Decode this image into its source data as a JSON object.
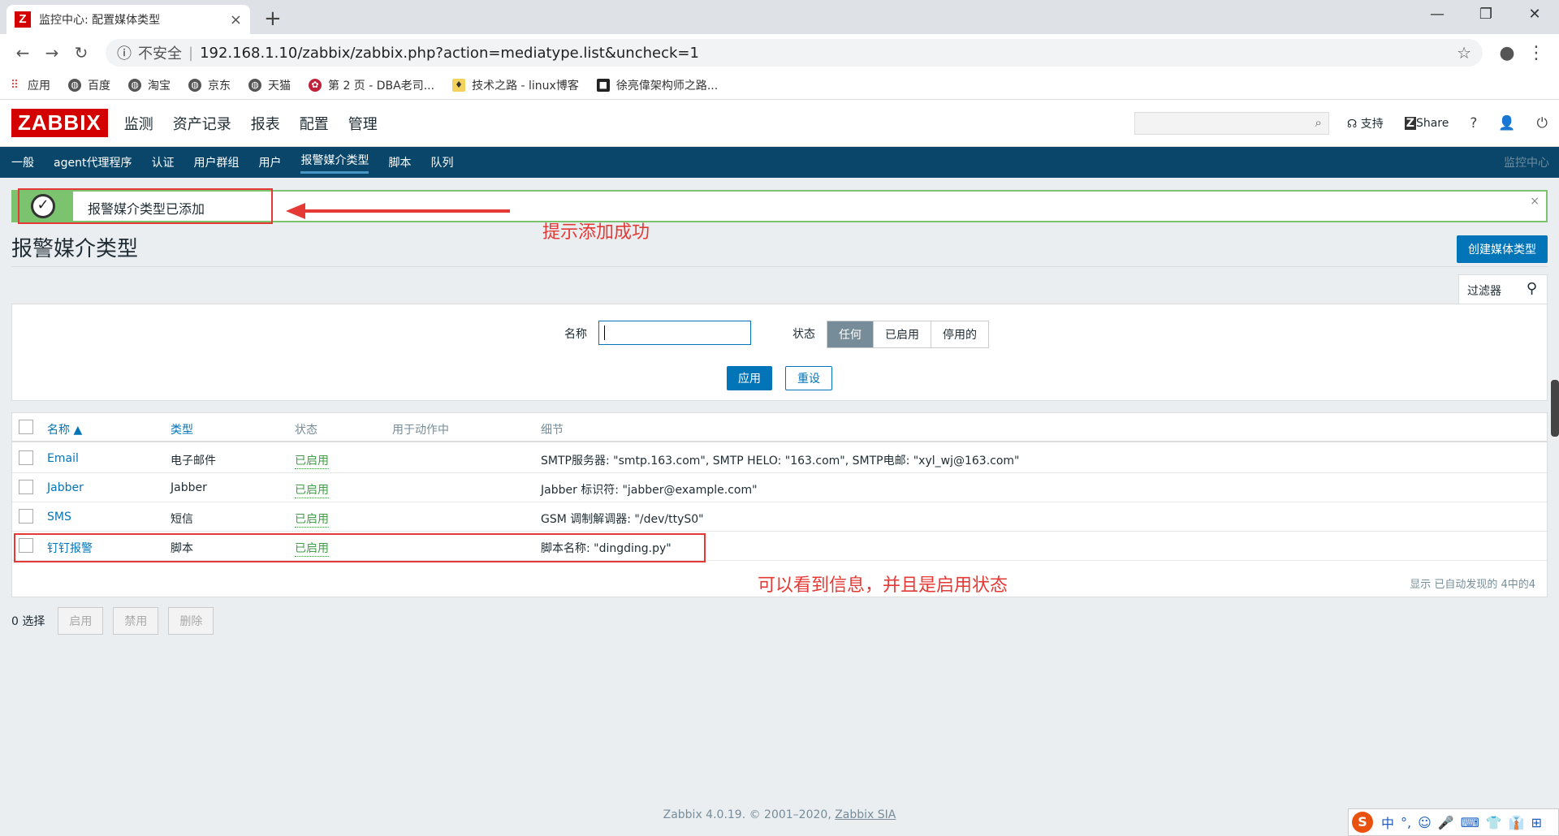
{
  "browser": {
    "tab_title": "监控中心: 配置媒体类型",
    "tab_icon": "Z",
    "insecure_label": "不安全",
    "url": "192.168.1.10/zabbix/zabbix.php?action=mediatype.list&uncheck=1",
    "bookmarks": [
      {
        "label": "应用",
        "icon": "apps-icon"
      },
      {
        "label": "百度",
        "icon": "globe-icon"
      },
      {
        "label": "淘宝",
        "icon": "globe-icon"
      },
      {
        "label": "京东",
        "icon": "globe-icon"
      },
      {
        "label": "天猫",
        "icon": "globe-icon"
      },
      {
        "label": "第 2 页 - DBA老司...",
        "icon": "rose-icon"
      },
      {
        "label": "技术之路 - linux博客",
        "icon": "bulb-icon"
      },
      {
        "label": "徐亮偉架构师之路...",
        "icon": "dark-icon"
      }
    ]
  },
  "zabbix": {
    "logo": "ZABBIX",
    "top_menu": [
      "监测",
      "资产记录",
      "报表",
      "配置",
      "管理"
    ],
    "support": "支持",
    "share": "Share",
    "help": "?",
    "sub_menu": [
      "一般",
      "agent代理程序",
      "认证",
      "用户群组",
      "用户",
      "报警媒介类型",
      "脚本",
      "队列"
    ],
    "sub_menu_active": 5,
    "crumb": "监控中心"
  },
  "message": {
    "text": "报警媒介类型已添加",
    "close": "×"
  },
  "annotations": {
    "success": "提示添加成功",
    "info": "可以看到信息，并且是启用状态"
  },
  "page": {
    "title": "报警媒介类型",
    "create_button": "创建媒体类型",
    "filter_tab": "过滤器"
  },
  "filter": {
    "name_label": "名称",
    "name_value": "",
    "status_label": "状态",
    "status_options": [
      "任何",
      "已启用",
      "停用的"
    ],
    "status_selected": "任何",
    "apply": "应用",
    "reset": "重设"
  },
  "table": {
    "headers": [
      "名称 ▲",
      "类型",
      "状态",
      "用于动作中",
      "细节"
    ],
    "rows": [
      {
        "name": "Email",
        "type": "电子邮件",
        "status": "已启用",
        "actions": "",
        "details": "SMTP服务器: \"smtp.163.com\", SMTP HELO: \"163.com\", SMTP电邮: \"xyl_wj@163.com\""
      },
      {
        "name": "Jabber",
        "type": "Jabber",
        "status": "已启用",
        "actions": "",
        "details": "Jabber 标识符: \"jabber@example.com\""
      },
      {
        "name": "SMS",
        "type": "短信",
        "status": "已启用",
        "actions": "",
        "details": "GSM 调制解调器: \"/dev/ttyS0\""
      },
      {
        "name": "钉钉报警",
        "type": "脚本",
        "status": "已启用",
        "actions": "",
        "details": "脚本名称: \"dingding.py\""
      }
    ],
    "summary": "显示 已自动发现的 4中的4"
  },
  "bulk": {
    "selected": "0 选择",
    "buttons": [
      "启用",
      "禁用",
      "删除"
    ]
  },
  "footer": {
    "text": "Zabbix 4.0.19. © 2001–2020, ",
    "link": "Zabbix SIA"
  },
  "ime": {
    "logo": "S",
    "items": [
      "中",
      "°,",
      "☺",
      "🎤",
      "⌨",
      "👕",
      "👔",
      "⊞"
    ]
  }
}
